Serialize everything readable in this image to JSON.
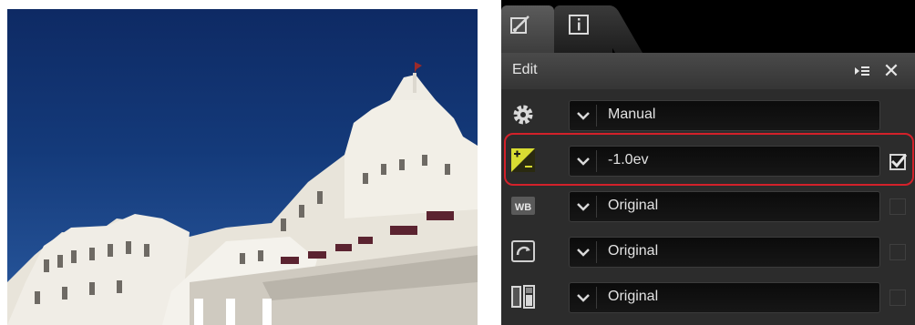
{
  "panel": {
    "tabs": [
      {
        "icon": "adjust-brush-icon",
        "active": true
      },
      {
        "icon": "info-icon",
        "active": false
      }
    ],
    "header": {
      "title": "Edit",
      "menu_icon": "play-list-icon",
      "close_label": "✕"
    },
    "rows": [
      {
        "icon": "gear-icon",
        "value": "Manual",
        "has_checkbox": false
      },
      {
        "icon": "exposure-compensation-icon",
        "value": "-1.0ev",
        "has_checkbox": true,
        "checked": true,
        "highlighted": true
      },
      {
        "icon": "white-balance-icon",
        "value": "Original",
        "has_checkbox": true,
        "checked": false
      },
      {
        "icon": "picture-control-icon",
        "value": "Original",
        "has_checkbox": true,
        "checked": false
      },
      {
        "icon": "active-d-lighting-icon",
        "value": "Original",
        "has_checkbox": true,
        "checked": false
      }
    ],
    "colors": {
      "highlight": "#d3212a",
      "exposure_icon": "#d8dc32"
    }
  },
  "photo": {
    "subject": "white-building-under-blue-sky"
  }
}
